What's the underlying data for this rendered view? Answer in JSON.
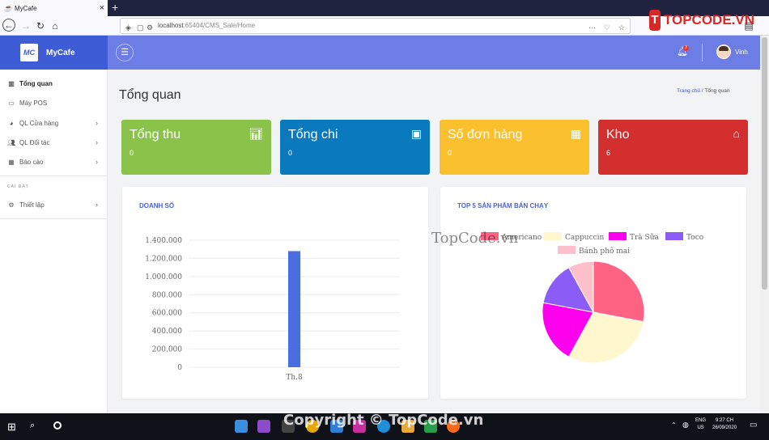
{
  "browser": {
    "tab_title": "MyCafe",
    "tab_close": "×",
    "new_tab": "+",
    "url_host": "localhost",
    "url_rest": ":65404/CMS_Sale/Home"
  },
  "brand_logo": {
    "mark": "T",
    "text": "TOPCODE.VN"
  },
  "app": {
    "logo_text": "MC",
    "name": "MyCafe",
    "user": "Vinh",
    "notification_count": "3"
  },
  "sidebar": {
    "items": [
      {
        "label": "Tổng quan",
        "icon": "chart-icon",
        "active": true
      },
      {
        "label": "Máy POS",
        "icon": "monitor-icon"
      },
      {
        "label": "QL Cửa hàng",
        "icon": "pie-icon",
        "chevron": true
      },
      {
        "label": "QL Đối tác",
        "icon": "users-icon",
        "chevron": true
      },
      {
        "label": "Báo cáo",
        "icon": "table-icon",
        "chevron": true
      }
    ],
    "section_heading": "CÀI ĐẶT",
    "settings_item": {
      "label": "Thiết lập",
      "icon": "gear-icon"
    }
  },
  "page": {
    "title": "Tổng quan",
    "breadcrumb_home": "Trang chủ",
    "breadcrumb_sep": "/",
    "breadcrumb_current": "Tổng quan"
  },
  "stats": [
    {
      "label": "Tổng thu",
      "value": "0",
      "color": "#8bc34a",
      "icon": "bar-chart-icon"
    },
    {
      "label": "Tổng chi",
      "value": "0",
      "color": "#0a79bd",
      "icon": "window-icon"
    },
    {
      "label": "Số đơn hàng",
      "value": "0",
      "color": "#fbc02d",
      "icon": "calendar-icon"
    },
    {
      "label": "Kho",
      "value": "6",
      "color": "#d32f2f",
      "icon": "warehouse-icon"
    }
  ],
  "cards": {
    "sales_title": "DOANH SỐ",
    "top5_title": "TOP 5 SẢN PHẨM BÁN CHẠY"
  },
  "chart_data": [
    {
      "type": "bar",
      "title": "DOANH SỐ",
      "categories": [
        "Th.8"
      ],
      "values": [
        1280000
      ],
      "ylim": [
        0,
        1400000
      ],
      "yticks": [
        "0",
        "200.000",
        "400.000",
        "600.000",
        "800.000",
        "1.000.000",
        "1.200.000",
        "1.400.000"
      ],
      "bar_color": "#4a6ee0",
      "grid": true
    },
    {
      "type": "pie",
      "title": "TOP 5 SẢN PHẨM BÁN CHẠY",
      "legend_position": "top",
      "slices": [
        {
          "name": "Americano",
          "value": 28,
          "color": "#ff6384"
        },
        {
          "name": "Cappuccin",
          "value": 30,
          "color": "#fff8cf"
        },
        {
          "name": "Trà Sữa",
          "value": 20,
          "color": "#ff00ee"
        },
        {
          "name": "Toco",
          "value": 14,
          "color": "#8b5cf6"
        },
        {
          "name": "Bánh phô mai",
          "value": 8,
          "color": "#ffc0cb"
        }
      ]
    }
  ],
  "watermarks": {
    "center": "TopCode.vn",
    "bottom": "Copyright © TopCode.vn"
  },
  "taskbar": {
    "lang": "ENG",
    "region": "US",
    "time": "9:27 CH",
    "date": "26/09/2020"
  }
}
